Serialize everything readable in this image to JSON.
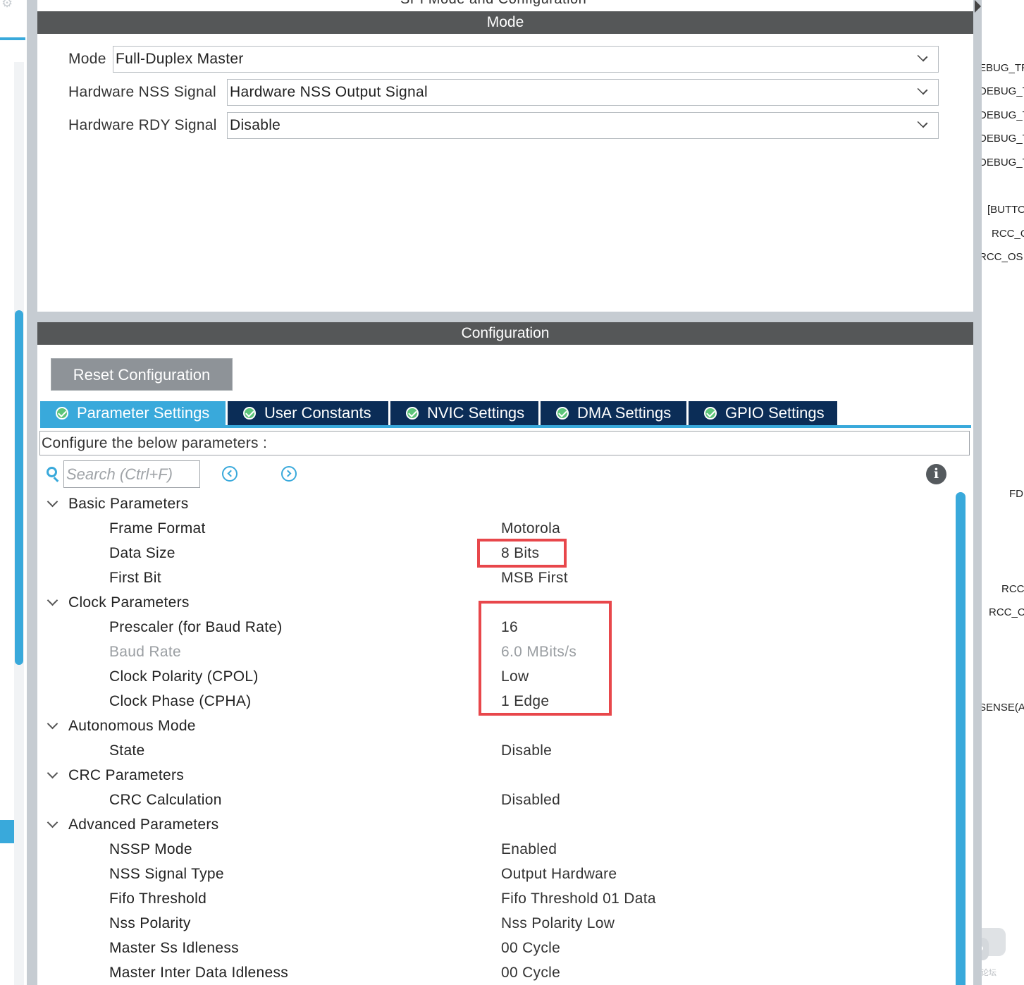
{
  "window": {
    "title_partial": "SPI Mode and Configuration"
  },
  "mode_section": {
    "title": "Mode",
    "rows": [
      {
        "label": "Mode",
        "value": "Full-Duplex Master"
      },
      {
        "label": "Hardware NSS Signal",
        "value": "Hardware NSS Output Signal"
      },
      {
        "label": "Hardware RDY Signal",
        "value": "Disable"
      }
    ]
  },
  "config_section": {
    "title": "Configuration",
    "reset_label": "Reset Configuration",
    "tabs": [
      {
        "label": "Parameter Settings",
        "active": true
      },
      {
        "label": "User Constants",
        "active": false
      },
      {
        "label": "NVIC Settings",
        "active": false
      },
      {
        "label": "DMA Settings",
        "active": false
      },
      {
        "label": "GPIO Settings",
        "active": false
      }
    ],
    "description": "Configure the below parameters :",
    "search": {
      "placeholder": "Search (Ctrl+F)",
      "value": ""
    },
    "groups": [
      {
        "name": "Basic Parameters",
        "params": [
          {
            "name": "Frame Format",
            "value": "Motorola"
          },
          {
            "name": "Data Size",
            "value": "8 Bits"
          },
          {
            "name": "First Bit",
            "value": "MSB First"
          }
        ]
      },
      {
        "name": "Clock Parameters",
        "params": [
          {
            "name": "Prescaler (for Baud Rate)",
            "value": "16"
          },
          {
            "name": "Baud Rate",
            "value": "6.0 MBits/s",
            "disabled": true
          },
          {
            "name": "Clock Polarity (CPOL)",
            "value": "Low"
          },
          {
            "name": "Clock Phase (CPHA)",
            "value": "1 Edge"
          }
        ]
      },
      {
        "name": "Autonomous Mode",
        "params": [
          {
            "name": "State",
            "value": "Disable"
          }
        ]
      },
      {
        "name": "CRC Parameters",
        "params": [
          {
            "name": "CRC Calculation",
            "value": "Disabled"
          }
        ]
      },
      {
        "name": "Advanced Parameters",
        "params": [
          {
            "name": "NSSP Mode",
            "value": "Enabled"
          },
          {
            "name": "NSS Signal Type",
            "value": "Output Hardware"
          },
          {
            "name": "Fifo Threshold",
            "value": "Fifo Threshold 01 Data"
          },
          {
            "name": "Nss Polarity",
            "value": "Nss Polarity Low"
          },
          {
            "name": "Master Ss Idleness",
            "value": "00 Cycle"
          },
          {
            "name": "Master Inter Data Idleness",
            "value": "00 Cycle"
          }
        ]
      }
    ]
  },
  "right_labels": [
    "EBUG_TR",
    "DEBUG_T",
    "DEBUG_T",
    "DEBUG_T",
    "DEBUG_T",
    "[BUTTO",
    "RCC_O",
    "RCC_OS",
    "FD",
    "RCC",
    "RCC_O",
    "SENSE(A"
  ],
  "watermark_text": "ST中文论坛",
  "colors": {
    "accent": "#39a9db",
    "tab_dark": "#0b2d57",
    "header_bar": "#555758",
    "highlight": "#e8474b"
  }
}
